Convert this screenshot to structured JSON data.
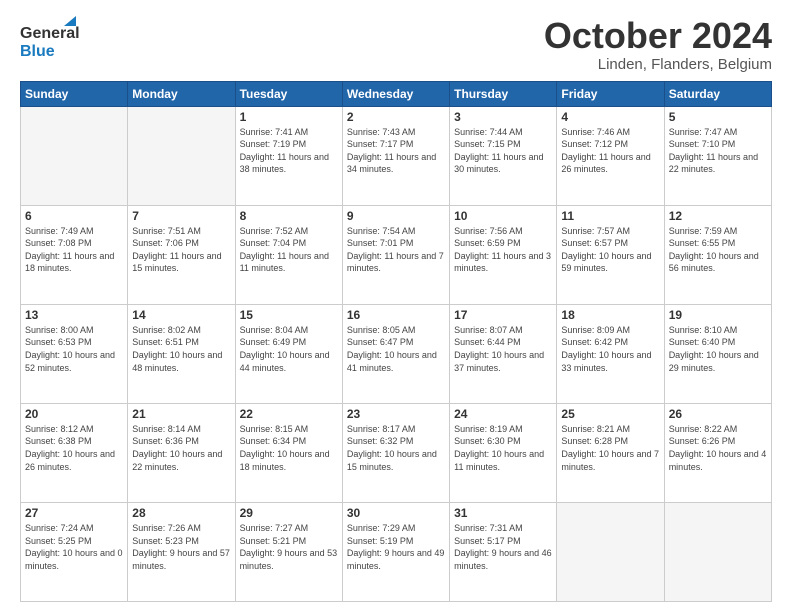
{
  "header": {
    "logo_general": "General",
    "logo_blue": "Blue",
    "month": "October 2024",
    "location": "Linden, Flanders, Belgium"
  },
  "days_of_week": [
    "Sunday",
    "Monday",
    "Tuesday",
    "Wednesday",
    "Thursday",
    "Friday",
    "Saturday"
  ],
  "weeks": [
    [
      {
        "num": "",
        "sunrise": "",
        "sunset": "",
        "daylight": ""
      },
      {
        "num": "",
        "sunrise": "",
        "sunset": "",
        "daylight": ""
      },
      {
        "num": "1",
        "sunrise": "Sunrise: 7:41 AM",
        "sunset": "Sunset: 7:19 PM",
        "daylight": "Daylight: 11 hours and 38 minutes."
      },
      {
        "num": "2",
        "sunrise": "Sunrise: 7:43 AM",
        "sunset": "Sunset: 7:17 PM",
        "daylight": "Daylight: 11 hours and 34 minutes."
      },
      {
        "num": "3",
        "sunrise": "Sunrise: 7:44 AM",
        "sunset": "Sunset: 7:15 PM",
        "daylight": "Daylight: 11 hours and 30 minutes."
      },
      {
        "num": "4",
        "sunrise": "Sunrise: 7:46 AM",
        "sunset": "Sunset: 7:12 PM",
        "daylight": "Daylight: 11 hours and 26 minutes."
      },
      {
        "num": "5",
        "sunrise": "Sunrise: 7:47 AM",
        "sunset": "Sunset: 7:10 PM",
        "daylight": "Daylight: 11 hours and 22 minutes."
      }
    ],
    [
      {
        "num": "6",
        "sunrise": "Sunrise: 7:49 AM",
        "sunset": "Sunset: 7:08 PM",
        "daylight": "Daylight: 11 hours and 18 minutes."
      },
      {
        "num": "7",
        "sunrise": "Sunrise: 7:51 AM",
        "sunset": "Sunset: 7:06 PM",
        "daylight": "Daylight: 11 hours and 15 minutes."
      },
      {
        "num": "8",
        "sunrise": "Sunrise: 7:52 AM",
        "sunset": "Sunset: 7:04 PM",
        "daylight": "Daylight: 11 hours and 11 minutes."
      },
      {
        "num": "9",
        "sunrise": "Sunrise: 7:54 AM",
        "sunset": "Sunset: 7:01 PM",
        "daylight": "Daylight: 11 hours and 7 minutes."
      },
      {
        "num": "10",
        "sunrise": "Sunrise: 7:56 AM",
        "sunset": "Sunset: 6:59 PM",
        "daylight": "Daylight: 11 hours and 3 minutes."
      },
      {
        "num": "11",
        "sunrise": "Sunrise: 7:57 AM",
        "sunset": "Sunset: 6:57 PM",
        "daylight": "Daylight: 10 hours and 59 minutes."
      },
      {
        "num": "12",
        "sunrise": "Sunrise: 7:59 AM",
        "sunset": "Sunset: 6:55 PM",
        "daylight": "Daylight: 10 hours and 56 minutes."
      }
    ],
    [
      {
        "num": "13",
        "sunrise": "Sunrise: 8:00 AM",
        "sunset": "Sunset: 6:53 PM",
        "daylight": "Daylight: 10 hours and 52 minutes."
      },
      {
        "num": "14",
        "sunrise": "Sunrise: 8:02 AM",
        "sunset": "Sunset: 6:51 PM",
        "daylight": "Daylight: 10 hours and 48 minutes."
      },
      {
        "num": "15",
        "sunrise": "Sunrise: 8:04 AM",
        "sunset": "Sunset: 6:49 PM",
        "daylight": "Daylight: 10 hours and 44 minutes."
      },
      {
        "num": "16",
        "sunrise": "Sunrise: 8:05 AM",
        "sunset": "Sunset: 6:47 PM",
        "daylight": "Daylight: 10 hours and 41 minutes."
      },
      {
        "num": "17",
        "sunrise": "Sunrise: 8:07 AM",
        "sunset": "Sunset: 6:44 PM",
        "daylight": "Daylight: 10 hours and 37 minutes."
      },
      {
        "num": "18",
        "sunrise": "Sunrise: 8:09 AM",
        "sunset": "Sunset: 6:42 PM",
        "daylight": "Daylight: 10 hours and 33 minutes."
      },
      {
        "num": "19",
        "sunrise": "Sunrise: 8:10 AM",
        "sunset": "Sunset: 6:40 PM",
        "daylight": "Daylight: 10 hours and 29 minutes."
      }
    ],
    [
      {
        "num": "20",
        "sunrise": "Sunrise: 8:12 AM",
        "sunset": "Sunset: 6:38 PM",
        "daylight": "Daylight: 10 hours and 26 minutes."
      },
      {
        "num": "21",
        "sunrise": "Sunrise: 8:14 AM",
        "sunset": "Sunset: 6:36 PM",
        "daylight": "Daylight: 10 hours and 22 minutes."
      },
      {
        "num": "22",
        "sunrise": "Sunrise: 8:15 AM",
        "sunset": "Sunset: 6:34 PM",
        "daylight": "Daylight: 10 hours and 18 minutes."
      },
      {
        "num": "23",
        "sunrise": "Sunrise: 8:17 AM",
        "sunset": "Sunset: 6:32 PM",
        "daylight": "Daylight: 10 hours and 15 minutes."
      },
      {
        "num": "24",
        "sunrise": "Sunrise: 8:19 AM",
        "sunset": "Sunset: 6:30 PM",
        "daylight": "Daylight: 10 hours and 11 minutes."
      },
      {
        "num": "25",
        "sunrise": "Sunrise: 8:21 AM",
        "sunset": "Sunset: 6:28 PM",
        "daylight": "Daylight: 10 hours and 7 minutes."
      },
      {
        "num": "26",
        "sunrise": "Sunrise: 8:22 AM",
        "sunset": "Sunset: 6:26 PM",
        "daylight": "Daylight: 10 hours and 4 minutes."
      }
    ],
    [
      {
        "num": "27",
        "sunrise": "Sunrise: 7:24 AM",
        "sunset": "Sunset: 5:25 PM",
        "daylight": "Daylight: 10 hours and 0 minutes."
      },
      {
        "num": "28",
        "sunrise": "Sunrise: 7:26 AM",
        "sunset": "Sunset: 5:23 PM",
        "daylight": "Daylight: 9 hours and 57 minutes."
      },
      {
        "num": "29",
        "sunrise": "Sunrise: 7:27 AM",
        "sunset": "Sunset: 5:21 PM",
        "daylight": "Daylight: 9 hours and 53 minutes."
      },
      {
        "num": "30",
        "sunrise": "Sunrise: 7:29 AM",
        "sunset": "Sunset: 5:19 PM",
        "daylight": "Daylight: 9 hours and 49 minutes."
      },
      {
        "num": "31",
        "sunrise": "Sunrise: 7:31 AM",
        "sunset": "Sunset: 5:17 PM",
        "daylight": "Daylight: 9 hours and 46 minutes."
      },
      {
        "num": "",
        "sunrise": "",
        "sunset": "",
        "daylight": ""
      },
      {
        "num": "",
        "sunrise": "",
        "sunset": "",
        "daylight": ""
      }
    ]
  ]
}
